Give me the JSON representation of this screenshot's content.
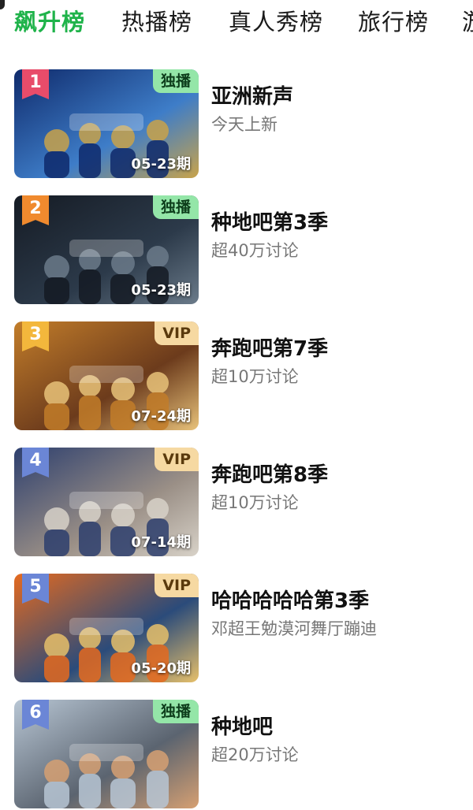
{
  "tabs": [
    {
      "label": "飙升榜",
      "active": true
    },
    {
      "label": "热播榜",
      "active": false
    },
    {
      "label": "真人秀榜",
      "active": false
    },
    {
      "label": "旅行榜",
      "active": false
    },
    {
      "label": "游",
      "active": false
    }
  ],
  "items": [
    {
      "rank": "1",
      "title": "亚洲新声",
      "subtitle": "今天上新",
      "tag": "独播",
      "tag_type": "excl",
      "date": "05-23期",
      "rank_color": "#e84c6a",
      "thumb": [
        "#0f2a6b",
        "#3e7dc8",
        "#c8a34a"
      ]
    },
    {
      "rank": "2",
      "title": "种地吧第3季",
      "subtitle": "超40万讨论",
      "tag": "独播",
      "tag_type": "excl",
      "date": "05-23期",
      "rank_color": "#f08a2e",
      "thumb": [
        "#151b24",
        "#2c3a4a",
        "#6b7b8a"
      ]
    },
    {
      "rank": "3",
      "title": "奔跑吧第7季",
      "subtitle": "超10万讨论",
      "tag": "VIP",
      "tag_type": "vip",
      "date": "07-24期",
      "rank_color": "#f3b73c",
      "thumb": [
        "#c27d2a",
        "#6c3b1c",
        "#e8c27a"
      ]
    },
    {
      "rank": "4",
      "title": "奔跑吧第8季",
      "subtitle": "超10万讨论",
      "tag": "VIP",
      "tag_type": "vip",
      "date": "07-14期",
      "rank_color": "#6b86d6",
      "thumb": [
        "#2d3f6e",
        "#9a8f86",
        "#d8d2c8"
      ]
    },
    {
      "rank": "5",
      "title": "哈哈哈哈哈第3季",
      "subtitle": "邓超王勉漠河舞厅蹦迪",
      "tag": "VIP",
      "tag_type": "vip",
      "date": "05-20期",
      "rank_color": "#6b86d6",
      "thumb": [
        "#e56a1f",
        "#2b4b7a",
        "#e7c06a"
      ]
    },
    {
      "rank": "6",
      "title": "种地吧",
      "subtitle": "超20万讨论",
      "tag": "独播",
      "tag_type": "excl",
      "date": "",
      "rank_color": "#6b86d6",
      "thumb": [
        "#b8c6d4",
        "#5b6470",
        "#d6a072"
      ]
    }
  ]
}
